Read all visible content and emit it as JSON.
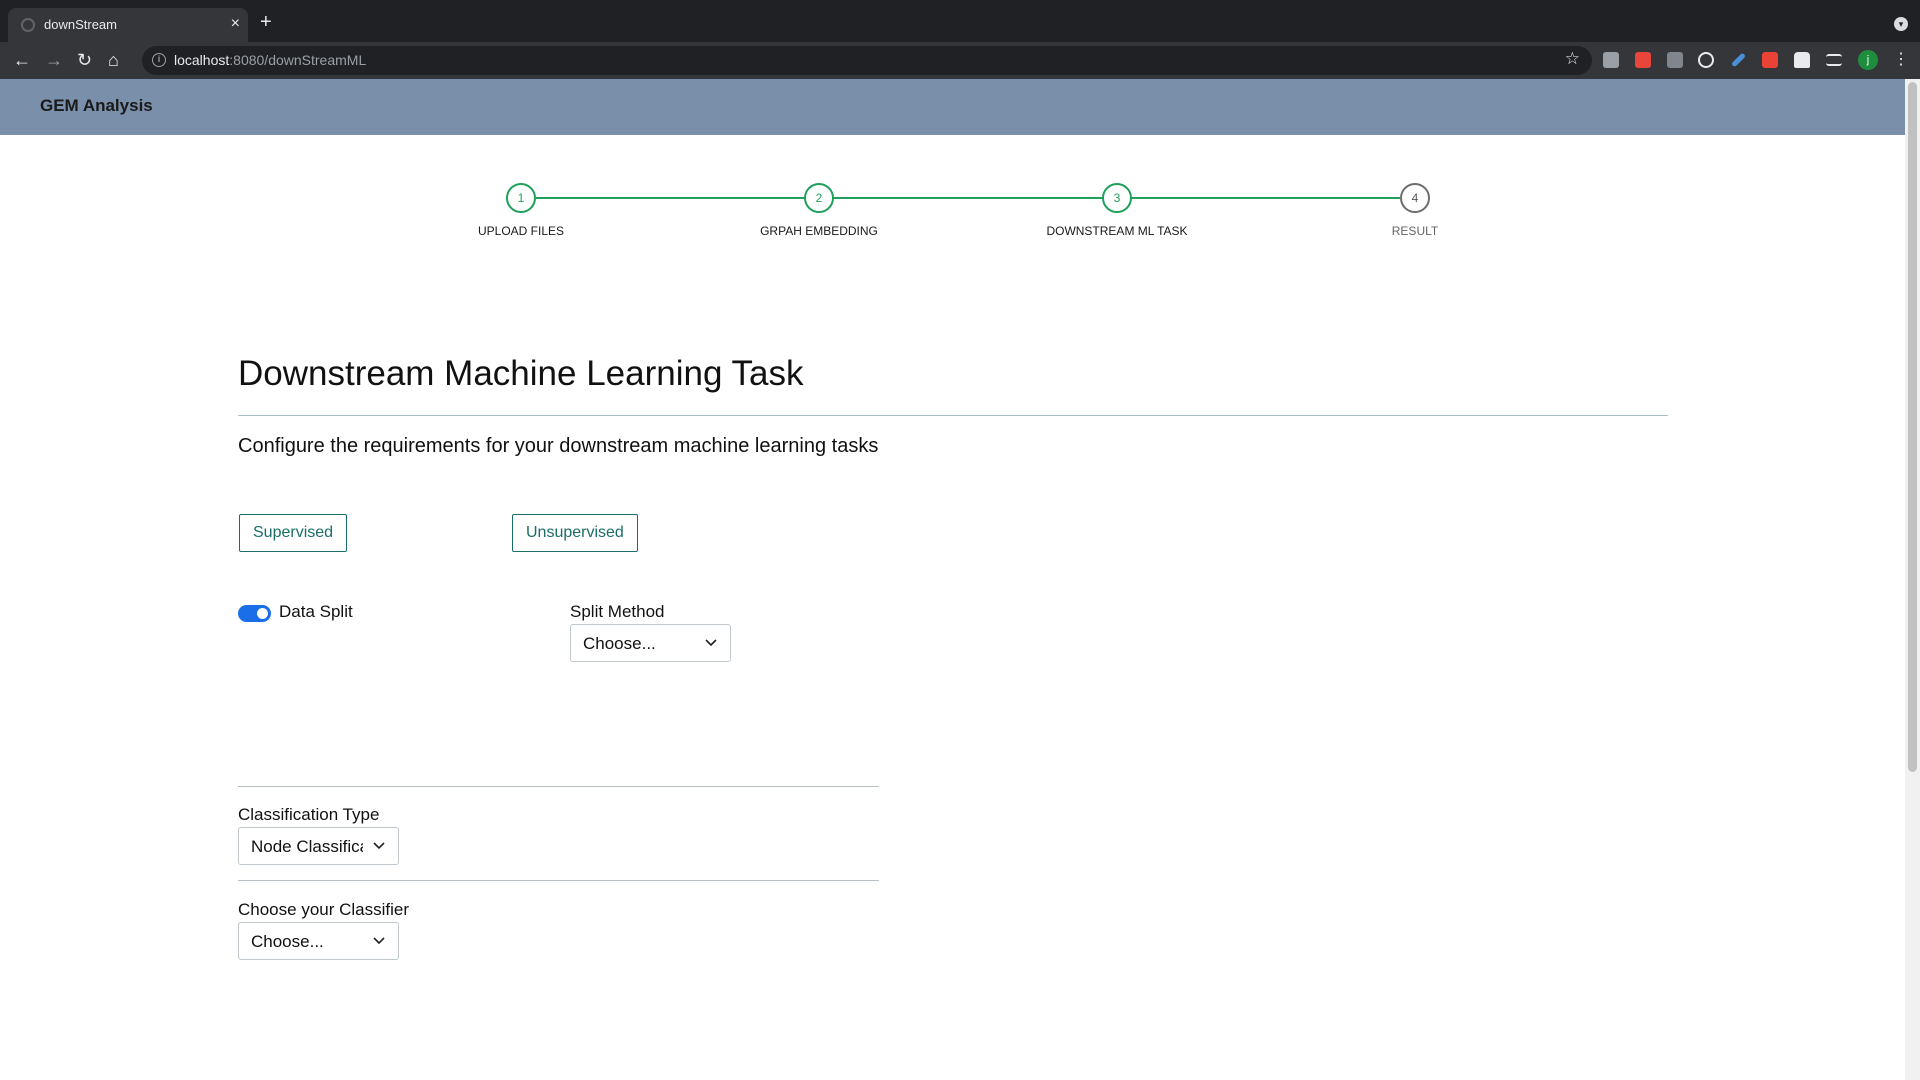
{
  "browser": {
    "tab_title": "downStream",
    "tab_close": "×",
    "new_tab": "+",
    "url_host": "localhost",
    "url_path": ":8080/downStreamML",
    "avatar_letter": "j"
  },
  "app": {
    "title": "GEM Analysis"
  },
  "stepper": {
    "steps": [
      {
        "number": "1",
        "label": "UPLOAD FILES",
        "state": "complete"
      },
      {
        "number": "2",
        "label": "GRPAH EMBEDDING",
        "state": "complete"
      },
      {
        "number": "3",
        "label": "DOWNSTREAM ML TASK",
        "state": "active"
      },
      {
        "number": "4",
        "label": "RESULT",
        "state": "pending"
      }
    ],
    "active_color": "#1ea05a"
  },
  "main": {
    "title": "Downstream Machine Learning Task",
    "subtitle": "Configure the requirements for your downstream machine learning tasks",
    "mode_buttons": {
      "supervised": "Supervised",
      "unsupervised": "Unsupervised"
    },
    "data_split": {
      "label": "Data Split",
      "enabled": true
    },
    "split_method": {
      "label": "Split Method",
      "value": "Choose..."
    },
    "classification_type": {
      "label": "Classification Type",
      "value": "Node Classification"
    },
    "classifier": {
      "label": "Choose your Classifier",
      "value": "Choose..."
    }
  },
  "colors": {
    "appbar": "#7a8fa9",
    "accent": "#1a6e68",
    "toggle": "#1a6fe8"
  }
}
